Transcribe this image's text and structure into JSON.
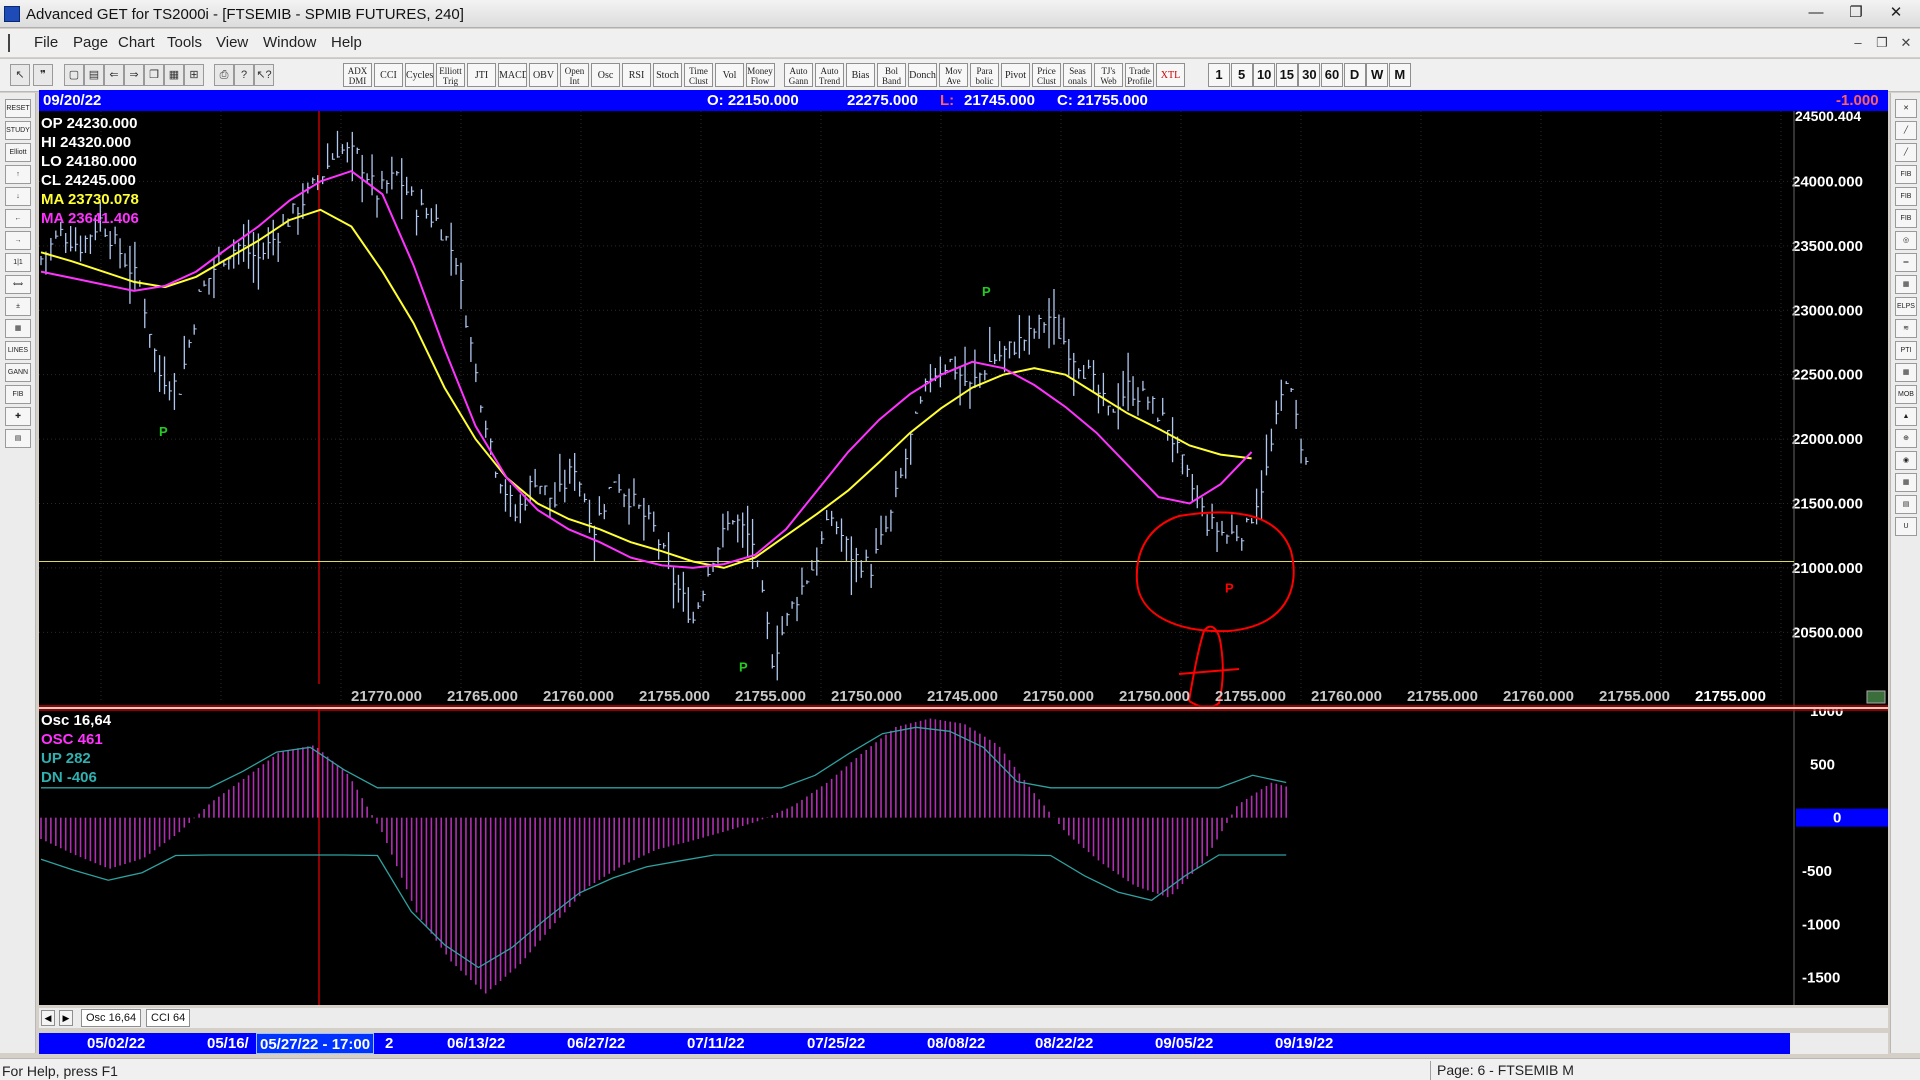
{
  "window": {
    "title": "Advanced GET for TS2000i - [FTSEMIB - SPMIB FUTURES, 240]",
    "min_glyph": "—",
    "max_glyph": "❐",
    "close_glyph": "✕"
  },
  "menu": {
    "items": [
      "File",
      "Page",
      "Chart",
      "Tools",
      "View",
      "Window",
      "Help"
    ],
    "mdi_buttons": [
      "–",
      "❐",
      "✕"
    ]
  },
  "toolbar": {
    "indicators": [
      {
        "label": "ADX DMI",
        "two_line": true,
        "red": false
      },
      {
        "label": "CCI",
        "two_line": false,
        "red": false
      },
      {
        "label": "Cycles",
        "two_line": false,
        "red": false
      },
      {
        "label": "Elliott Trig",
        "two_line": true,
        "red": false
      },
      {
        "label": "JTI",
        "two_line": false,
        "red": false
      },
      {
        "label": "MACD",
        "two_line": false,
        "red": false
      },
      {
        "label": "OBV",
        "two_line": false,
        "red": false
      },
      {
        "label": "Open Int",
        "two_line": true,
        "red": false
      },
      {
        "label": "Osc",
        "two_line": false,
        "red": false
      },
      {
        "label": "RSI",
        "two_line": false,
        "red": false
      },
      {
        "label": "Stoch",
        "two_line": false,
        "red": false
      },
      {
        "label": "Time Clust",
        "two_line": true,
        "red": false
      },
      {
        "label": "Vol",
        "two_line": false,
        "red": false
      },
      {
        "label": "Money Flow",
        "two_line": true,
        "red": false
      },
      {
        "label": "Auto Gann",
        "two_line": true,
        "red": false
      },
      {
        "label": "Auto Trend",
        "two_line": true,
        "red": false
      },
      {
        "label": "Bias",
        "two_line": false,
        "red": false
      },
      {
        "label": "Bol Band",
        "two_line": true,
        "red": false
      },
      {
        "label": "Donch",
        "two_line": false,
        "red": false
      },
      {
        "label": "Mov Ave",
        "two_line": true,
        "red": false
      },
      {
        "label": "Para bolic",
        "two_line": true,
        "red": false
      },
      {
        "label": "Pivot",
        "two_line": false,
        "red": false
      },
      {
        "label": "Price Clust",
        "two_line": true,
        "red": false
      },
      {
        "label": "Seas onals",
        "two_line": true,
        "red": false
      },
      {
        "label": "TJ's Web",
        "two_line": true,
        "red": false
      },
      {
        "label": "Trade Profile",
        "two_line": true,
        "red": false
      },
      {
        "label": "XTL",
        "two_line": false,
        "red": true
      }
    ],
    "timeframes": [
      "1",
      "5",
      "10",
      "15",
      "30",
      "60",
      "D",
      "W",
      "M"
    ]
  },
  "left_tools": [
    "RESET",
    "STUDY",
    "Elliott",
    "↑",
    "↓",
    "←",
    "→",
    "1|1",
    "⟺",
    "±",
    "▦",
    "LINES",
    "GANN",
    "FIB",
    "✚",
    "▤"
  ],
  "right_tools": [
    "✕",
    "╱",
    "╱",
    "FIB RET",
    "FIB EXT",
    "FIB TIME",
    "◎",
    "═",
    "▦",
    "ELPS",
    "≋",
    "PTI",
    "▦",
    "MOB",
    "▲",
    "⊕",
    "◉",
    "▦",
    "▤",
    "U"
  ],
  "info_bar": {
    "date": "09/20/22",
    "open": "O: 22150.000",
    "high": "22275.000",
    "low_label": "L:",
    "low": "21745.000",
    "close": "C: 21755.000",
    "change": "-1.000"
  },
  "legend": {
    "op": "OP  24230.000",
    "hi": "HI   24320.000",
    "lo": "LO  24180.000",
    "cl": "CL  24245.000",
    "ma1": "MA  23730.078",
    "ma2": "MA  23641.406"
  },
  "price_axis": {
    "top_label": "24500.404",
    "labels": [
      "24000.000",
      "23500.000",
      "23000.000",
      "22500.000",
      "22000.000",
      "21500.000",
      "21000.000",
      "20500.000"
    ]
  },
  "bottom_value_row": [
    "21770.000",
    "21765.000",
    "21760.000",
    "21755.000",
    "21755.000",
    "21750.000",
    "21745.000",
    "21750.000",
    "21750.000",
    "21755.000",
    "21760.000",
    "21755.000",
    "21760.000",
    "21755.000",
    "21755.000"
  ],
  "pivot_marker": "P",
  "osc_panel": {
    "title": "Osc 16,64",
    "osc": "OSC 461",
    "up": "UP   282",
    "dn": "DN   -406",
    "axis_labels": [
      "1000",
      "500",
      "0",
      "-500",
      "-1000",
      "-1500"
    ]
  },
  "tabs": [
    "Osc 16,64",
    "CCI 64"
  ],
  "tab_arrows": [
    "◀",
    "▶"
  ],
  "date_axis": {
    "dates": [
      "05/02/22",
      "05/16/",
      "2",
      "06/13/22",
      "06/27/22",
      "07/11/22",
      "07/25/22",
      "08/08/22",
      "08/22/22",
      "09/05/22",
      "09/19/22"
    ],
    "cursor_date": "05/27/22 - 17:00"
  },
  "status": {
    "help": "For Help, press F1",
    "page": "Page: 6 - FTSEMIB M"
  },
  "colors": {
    "info_bar": "#0000ff",
    "ma_fast": "#ffff33",
    "ma_slow": "#ff33ff",
    "bars": "#b0c8f0",
    "pivot": "#22cc22",
    "annotation": "#ff0000",
    "osc_hist": "#b02fb0",
    "osc_bands": "#30a0a0"
  },
  "chart_data": {
    "type": "line",
    "series": [
      {
        "name": "FTSEMIB price (240 min bars, approx. close)",
        "x_index": [
          0,
          4,
          8,
          12,
          16,
          20,
          24,
          28,
          32,
          36,
          40,
          44,
          48,
          52,
          56,
          60,
          64,
          68,
          72,
          76,
          80,
          84,
          88,
          92,
          96,
          100,
          104,
          108,
          112,
          116,
          120,
          124,
          128,
          132,
          136,
          140,
          144,
          148,
          152,
          156,
          160,
          164,
          168,
          172,
          176,
          180,
          184,
          188,
          192,
          196,
          200,
          204,
          208,
          212,
          216,
          220,
          224,
          228,
          232,
          236,
          240,
          244,
          248,
          252,
          256
        ],
        "values": [
          23400,
          23600,
          23500,
          23700,
          23450,
          23200,
          22500,
          22400,
          23100,
          23400,
          23500,
          23400,
          23600,
          23800,
          24000,
          24250,
          24200,
          23900,
          24050,
          23800,
          23700,
          23400,
          22500,
          21800,
          21400,
          21700,
          21500,
          21800,
          21300,
          21700,
          21500,
          21300,
          20900,
          20600,
          21100,
          21400,
          21200,
          20300,
          20700,
          21000,
          21400,
          21100,
          21000,
          21400,
          22000,
          22500,
          22600,
          22400,
          22600,
          22700,
          22800,
          22950,
          22700,
          22500,
          22200,
          22400,
          22300,
          22100,
          21700,
          21350,
          21250,
          21300,
          21750,
          22500,
          21800
        ]
      }
    ],
    "ylim": [
      20200,
      24500
    ],
    "moving_averages": [
      {
        "name": "MA 23730.078",
        "values": [
          23450,
          23380,
          23300,
          23220,
          23180,
          23260,
          23400,
          23540,
          23700,
          23780,
          23650,
          23300,
          22900,
          22400,
          22000,
          21700,
          21500,
          21380,
          21300,
          21200,
          21130,
          21050,
          21000,
          21080,
          21250,
          21420,
          21600,
          21820,
          22050,
          22240,
          22400,
          22500,
          22550,
          22500,
          22350,
          22200,
          22080,
          21950,
          21880,
          21850
        ]
      },
      {
        "name": "MA 23641.406",
        "values": [
          23300,
          23250,
          23200,
          23150,
          23190,
          23300,
          23480,
          23650,
          23850,
          24000,
          24080,
          23900,
          23350,
          22700,
          22100,
          21700,
          21450,
          21300,
          21200,
          21080,
          21020,
          21000,
          21030,
          21100,
          21300,
          21600,
          21900,
          22150,
          22350,
          22500,
          22600,
          22550,
          22420,
          22250,
          22050,
          21800,
          21550,
          21500,
          21650,
          21900
        ]
      }
    ],
    "oscillator": {
      "name": "Osc 16,64",
      "ylim": [
        -1700,
        1000
      ],
      "values": [
        -200,
        -350,
        -480,
        -380,
        -150,
        150,
        380,
        620,
        680,
        400,
        -150,
        -900,
        -1350,
        -1650,
        -1380,
        -1000,
        -650,
        -450,
        -300,
        -220,
        -130,
        -30,
        110,
        330,
        600,
        850,
        930,
        880,
        680,
        250,
        -150,
        -420,
        -640,
        -750,
        -420,
        120,
        330,
        240
      ]
    }
  }
}
